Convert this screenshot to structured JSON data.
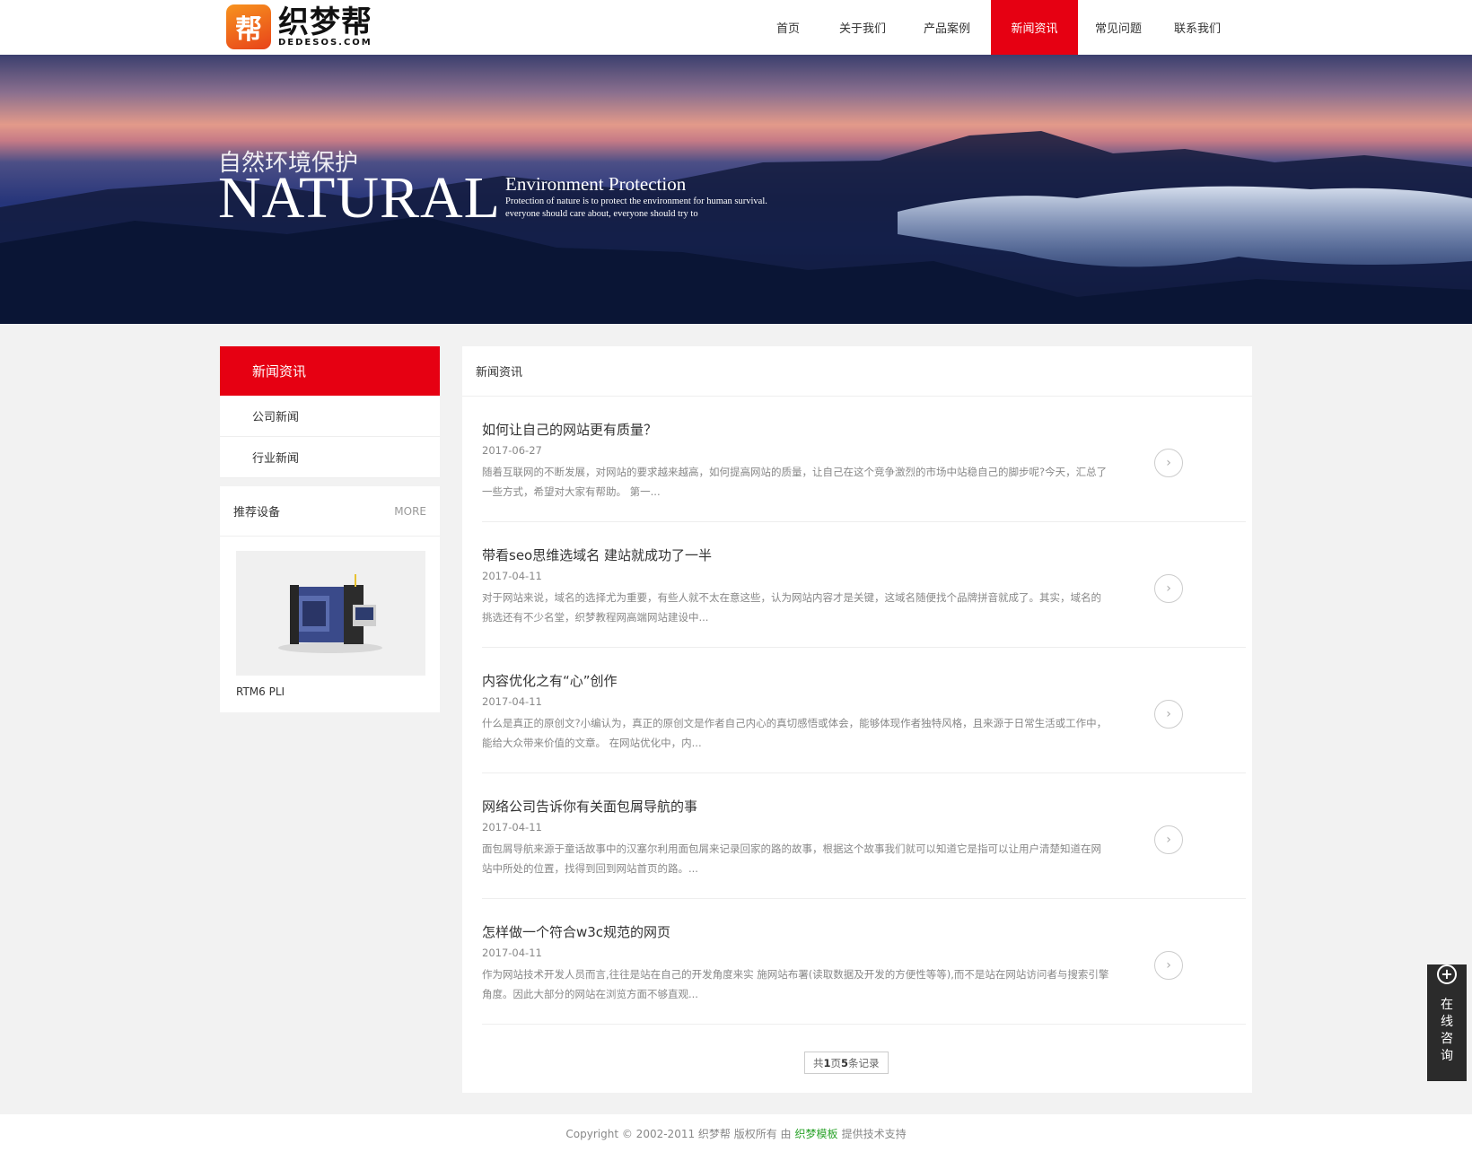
{
  "header": {
    "logo_badge": "帮",
    "logo_cn": "织梦帮",
    "logo_en": "DEDESOS.COM",
    "nav": [
      {
        "label": "首页",
        "width": 76
      },
      {
        "label": "关于我们",
        "width": 90
      },
      {
        "label": "产品案例",
        "width": 98
      },
      {
        "label": "新闻资讯",
        "width": 97,
        "active": true
      },
      {
        "label": "常见问题",
        "width": 90
      },
      {
        "label": "联系我们",
        "width": 86
      }
    ]
  },
  "banner": {
    "title_cn": "自然环境保护",
    "title_big": "NATURAL",
    "subtitle": "Environment Protection",
    "desc": "Protection of nature is to protect the environment for human survival. everyone should care about, everyone should try to"
  },
  "sidebar": {
    "category_title": "新闻资讯",
    "categories": [
      "公司新闻",
      "行业新闻"
    ],
    "recommend_title": "推荐设备",
    "more": "MORE",
    "product_name": "RTM6 PLI"
  },
  "main": {
    "heading": "新闻资讯",
    "news": [
      {
        "title": "如何让自己的网站更有质量？",
        "date": "2017-06-27",
        "desc": "随着互联网的不断发展，对网站的要求越来越高，如何提高网站的质量，让自己在这个竞争激烈的市场中站稳自己的脚步呢?今天，汇总了一些方式，希望对大家有帮助。 第一..."
      },
      {
        "title": "带看seo思维选域名 建站就成功了一半",
        "date": "2017-04-11",
        "desc": "对于网站来说，域名的选择尤为重要，有些人就不太在意这些，认为网站内容才是关键，这域名随便找个品牌拼音就成了。其实，域名的挑选还有不少名堂，织梦教程网高端网站建设中..."
      },
      {
        "title": "内容优化之有“心”创作",
        "date": "2017-04-11",
        "desc": "什么是真正的原创文?小编认为，真正的原创文是作者自己内心的真切感悟或体会，能够体现作者独特风格，且来源于日常生活或工作中，能给大众带来价值的文章。 在网站优化中，内..."
      },
      {
        "title": "网络公司告诉你有关面包屑导航的事",
        "date": "2017-04-11",
        "desc": "面包屑导航来源于童话故事中的汉塞尔利用面包屑来记录回家的路的故事，根据这个故事我们就可以知道它是指可以让用户清楚知道在网站中所处的位置，找得到回到网站首页的路。..."
      },
      {
        "title": "怎样做一个符合w3c规范的网页",
        "date": "2017-04-11",
        "desc": "作为网站技术开发人员而言,往往是站在自己的开发角度来实 施网站布署(读取数据及开发的方便性等等),而不是站在网站访问者与搜索引擎角度。因此大部分的网站在浏览方面不够直观..."
      }
    ],
    "pager": {
      "prefix": "共 ",
      "pages": "1",
      "mid": "页",
      "records": "5",
      "suffix": "条记录"
    }
  },
  "footer": {
    "before": "Copyright © 2002-2011 织梦帮 版权所有 由",
    "link": "织梦模板",
    "after": "提供技术支持"
  },
  "consult": {
    "plus": "+",
    "label": "在线咨询"
  },
  "colors": {
    "accent": "#e60012",
    "link": "#2aa32a"
  }
}
